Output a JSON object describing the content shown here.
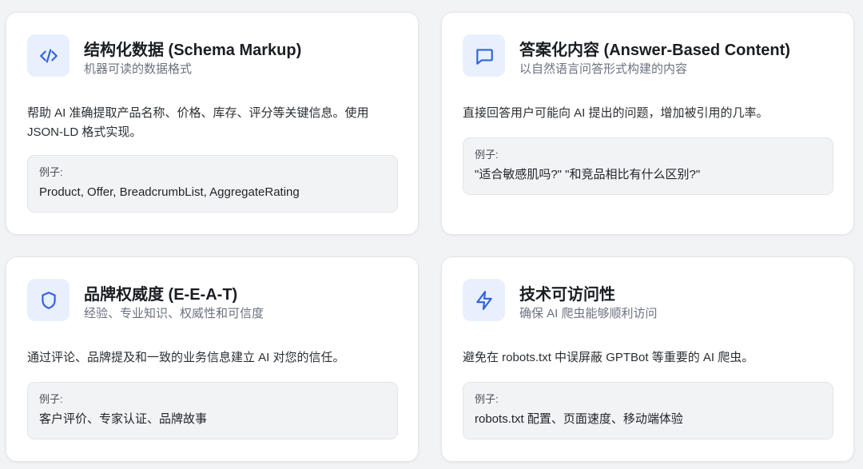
{
  "accent_color": "#2f63e0",
  "icon_bg_color": "#e9f0fd",
  "cards": [
    {
      "icon": "code-icon",
      "title": "结构化数据 (Schema Markup)",
      "subtitle": "机器可读的数据格式",
      "description": "帮助 AI 准确提取产品名称、价格、库存、评分等关键信息。使用 JSON-LD 格式实现。",
      "example_label": "例子:",
      "example_text": "Product, Offer, BreadcrumbList, AggregateRating"
    },
    {
      "icon": "chat-bubble-icon",
      "title": "答案化内容 (Answer-Based Content)",
      "subtitle": "以自然语言问答形式构建的内容",
      "description": "直接回答用户可能向 AI 提出的问题，增加被引用的几率。",
      "example_label": "例子:",
      "example_text": "\"适合敏感肌吗?\" \"和竞品相比有什么区别?\""
    },
    {
      "icon": "shield-icon",
      "title": "品牌权威度 (E-E-A-T)",
      "subtitle": "经验、专业知识、权威性和可信度",
      "description": "通过评论、品牌提及和一致的业务信息建立 AI 对您的信任。",
      "example_label": "例子:",
      "example_text": "客户评价、专家认证、品牌故事"
    },
    {
      "icon": "lightning-icon",
      "title": "技术可访问性",
      "subtitle": "确保 AI 爬虫能够顺利访问",
      "description": "避免在 robots.txt 中误屏蔽 GPTBot 等重要的 AI 爬虫。",
      "example_label": "例子:",
      "example_text": "robots.txt 配置、页面速度、移动端体验"
    }
  ]
}
